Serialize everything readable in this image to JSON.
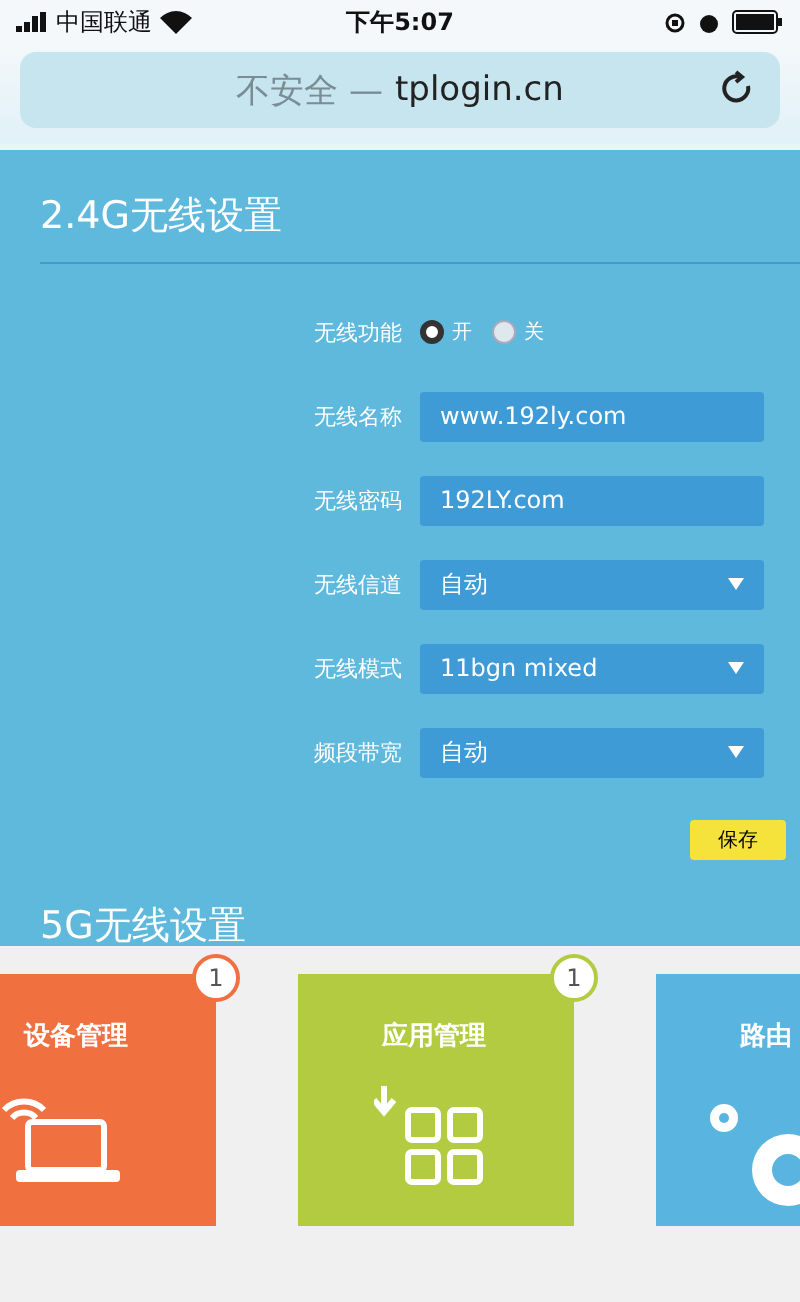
{
  "status_bar": {
    "carrier": "中国联通",
    "time": "下午5:07"
  },
  "address_bar": {
    "security": "不安全 —",
    "domain": "tplogin.cn"
  },
  "section": {
    "title": "2.4G无线设置",
    "rows": [
      {
        "kind": "radio",
        "label": "无线功能",
        "options": [
          {
            "label": "开",
            "selected": true
          },
          {
            "label": "关",
            "selected": false
          }
        ]
      },
      {
        "kind": "text",
        "label": "无线名称",
        "value": "www.192ly.com"
      },
      {
        "kind": "text",
        "label": "无线密码",
        "value": "192LY.com"
      },
      {
        "kind": "select",
        "label": "无线信道",
        "value": "自动"
      },
      {
        "kind": "select",
        "label": "无线模式",
        "value": "11bgn mixed"
      },
      {
        "kind": "select",
        "label": "频段带宽",
        "value": "自动"
      }
    ],
    "save": "保存"
  },
  "next_section": {
    "title": "5G无线设置"
  },
  "tiles": [
    {
      "kind": "device",
      "label": "设备管理",
      "badge": "1",
      "color": "#f07040"
    },
    {
      "kind": "apps",
      "label": "应用管理",
      "badge": "1",
      "color": "#b2cb40"
    },
    {
      "kind": "router",
      "label": "路由",
      "color": "#5ab4e0"
    }
  ]
}
